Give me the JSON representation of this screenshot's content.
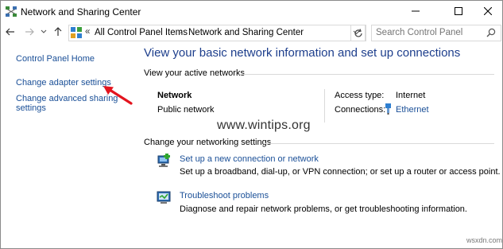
{
  "window": {
    "title": "Network and Sharing Center",
    "controls": {
      "minimize": "minimize-icon",
      "maximize": "maximize-icon",
      "close": "close-icon"
    }
  },
  "nav": {
    "icons": [
      "back-arrow-icon",
      "forward-arrow-icon",
      "recent-pages-chevron-icon",
      "up-arrow-icon"
    ],
    "breadcrumb": {
      "separator": "«",
      "items": [
        "All Control Panel Items",
        "Network and Sharing Center"
      ],
      "arrow": "›"
    },
    "search": {
      "placeholder": "Search Control Panel"
    }
  },
  "sidebar": {
    "home": "Control Panel Home",
    "links": [
      "Change adapter settings",
      "Change advanced sharing",
      "settings"
    ]
  },
  "main": {
    "heading": "View your basic network information and set up connections",
    "active_networks_label": "View your active networks",
    "network": {
      "name": "Network",
      "category": "Public network",
      "access_type_label": "Access type:",
      "access_type_value": "Internet",
      "connections_label": "Connections:",
      "connections_value": "Ethernet"
    },
    "settings_label": "Change your networking settings",
    "tasks": [
      {
        "title": "Set up a new connection or network",
        "desc": "Set up a broadband, dial-up, or VPN connection; or set up a router or access point."
      },
      {
        "title": "Troubleshoot problems",
        "desc": "Diagnose and repair network problems, or get troubleshooting information."
      }
    ]
  },
  "overlay": {
    "watermark": "www.wintips.org",
    "corner_mark": "wsxdn.com",
    "annotation_arrow_color": "#e3141e"
  },
  "colors": {
    "link": "#1a4f97",
    "heading": "#1d3e8c"
  }
}
